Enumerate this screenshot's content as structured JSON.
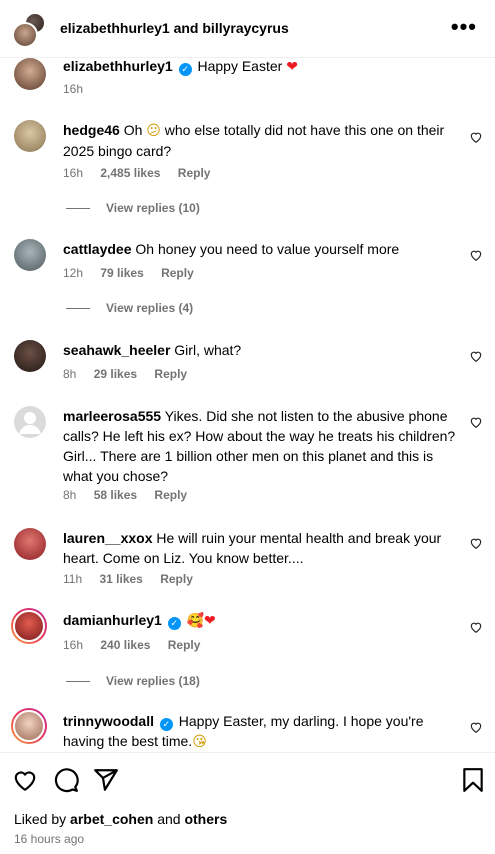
{
  "header": {
    "title": "elizabethhurley1 and billyraycyrus",
    "more_label": "•••"
  },
  "caption": {
    "username": "elizabethhurley1",
    "text": "Happy Easter",
    "emoji": "❤",
    "time": "16h"
  },
  "comments": [
    {
      "username": "hedge46",
      "text_before": "Oh",
      "emoji": "😕",
      "text_after": "who else totally did not have this one on their 2025 bingo card?",
      "time": "16h",
      "likes": "2,485 likes",
      "reply": "Reply",
      "view_replies": "View replies (10)"
    },
    {
      "username": "cattlaydee",
      "text": "Oh honey you need to value yourself more",
      "time": "12h",
      "likes": "79 likes",
      "reply": "Reply",
      "view_replies": "View replies (4)"
    },
    {
      "username": "seahawk_heeler",
      "text": "Girl, what?",
      "time": "8h",
      "likes": "29 likes",
      "reply": "Reply"
    },
    {
      "username": "marleerosa555",
      "text": "Yikes. Did she not listen to the abusive phone calls? He left his ex? How about the way he treats his children? Girl... There are 1 billion other men on this planet and this is what you chose?",
      "time": "8h",
      "likes": "58 likes",
      "reply": "Reply"
    },
    {
      "username": "lauren__xxox",
      "text": "He will ruin your mental health and break your heart. Come on Liz. You know better....",
      "time": "11h",
      "likes": "31 likes",
      "reply": "Reply"
    },
    {
      "username": "damianhurley1",
      "emoji_1": "🥰",
      "emoji_2": "❤",
      "time": "16h",
      "likes": "240 likes",
      "reply": "Reply",
      "view_replies": "View replies (18)"
    },
    {
      "username": "trinnywoodall",
      "text": "Happy Easter, my darling. I hope you're having the best time.",
      "emoji": "😘"
    }
  ],
  "footer": {
    "liked_by_prefix": "Liked by",
    "liked_by_user": "arbet_cohen",
    "liked_by_and": "and",
    "liked_by_others": "others",
    "time_ago": "16 hours ago"
  },
  "colors": {
    "secondary_text": "#737373",
    "verified_blue": "#0095f6",
    "heart_red": "#ed1c24"
  }
}
